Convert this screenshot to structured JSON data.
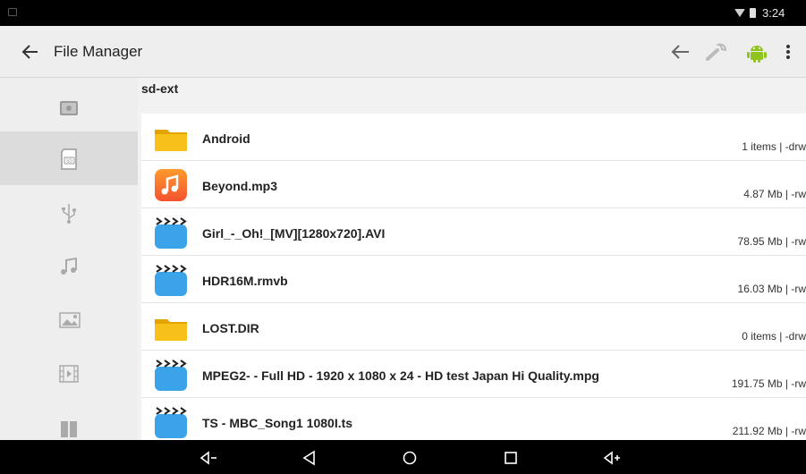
{
  "status_bar": {
    "time": "3:24"
  },
  "app_bar": {
    "title": "File Manager"
  },
  "path": "sd-ext",
  "sidebar": {
    "items": [
      {
        "icon": "drive-icon"
      },
      {
        "icon": "sd-card-icon",
        "label": "SD",
        "selected": true
      },
      {
        "icon": "usb-icon"
      },
      {
        "icon": "music-icon"
      },
      {
        "icon": "image-icon"
      },
      {
        "icon": "video-icon"
      },
      {
        "icon": "book-icon"
      }
    ]
  },
  "files": [
    {
      "name": "Android",
      "meta": "1 items | -drw",
      "type": "folder"
    },
    {
      "name": "Beyond.mp3",
      "meta": "4.87 Mb  | -rw",
      "type": "music"
    },
    {
      "name": "Girl_-_Oh!_[MV][1280x720].AVI",
      "meta": "78.95 Mb  | -rw",
      "type": "video"
    },
    {
      "name": "HDR16M.rmvb",
      "meta": "16.03 Mb  | -rw",
      "type": "video"
    },
    {
      "name": "LOST.DIR",
      "meta": "0 items | -drw",
      "type": "folder"
    },
    {
      "name": "MPEG2-  - Full HD -  1920 x 1080 x 24 -  HD test Japan Hi Quality.mpg",
      "meta": "191.75 Mb  | -rw",
      "type": "video"
    },
    {
      "name": "TS - MBC_Song1 1080I.ts",
      "meta": "211.92 Mb  | -rw",
      "type": "video"
    }
  ],
  "colors": {
    "folder": "#f5b800",
    "music": "#fb7a2a",
    "video": "#3ba4e8",
    "android": "#8fc31f"
  }
}
